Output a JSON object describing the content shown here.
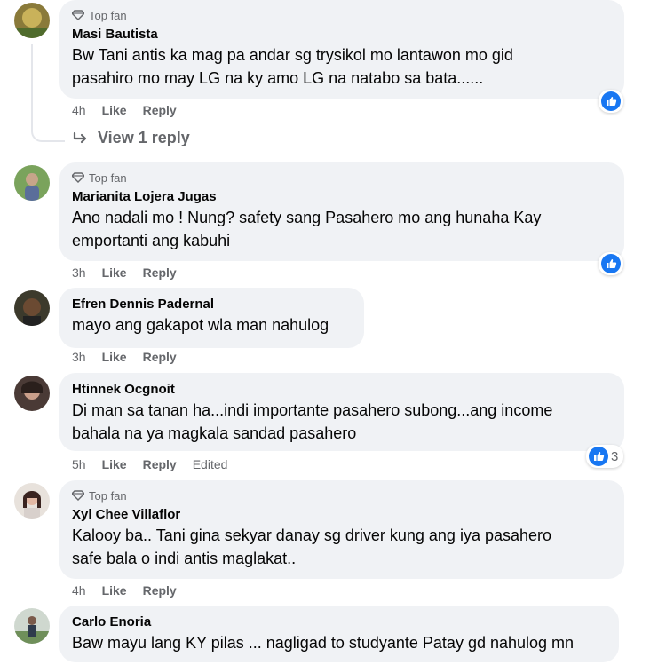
{
  "top_fan_label": "Top fan",
  "actions": {
    "like": "Like",
    "reply": "Reply",
    "edited": "Edited"
  },
  "view_reply": "View 1 reply",
  "comments": [
    {
      "name": "Masi Bautista",
      "top_fan": true,
      "lines": [
        "Bw Tani antis ka mag pa andar sg trysikol mo lantawon mo gid",
        "pasahiro mo may LG na ky amo LG na natabo sa bata......"
      ],
      "time": "4h",
      "reaction": "like",
      "reaction_count": ""
    },
    {
      "name": "Marianita Lojera Jugas",
      "top_fan": true,
      "lines": [
        "Ano nadali mo ! Nung? safety sang Pasahero mo ang hunaha Kay",
        "emportanti ang kabuhi"
      ],
      "time": "3h",
      "reaction": "like",
      "reaction_count": ""
    },
    {
      "name": "Efren Dennis Padernal",
      "top_fan": false,
      "lines": [
        "mayo ang gakapot wla man nahulog"
      ],
      "time": "3h"
    },
    {
      "name": "Htinnek Ocgnoit",
      "top_fan": false,
      "lines": [
        "Di man sa tanan ha...indi importante pasahero subong...ang income",
        "bahala na ya magkala sandad pasahero"
      ],
      "time": "5h",
      "edited": true,
      "reaction": "like",
      "reaction_count": "3"
    },
    {
      "name": "Xyl Chee Villaflor",
      "top_fan": true,
      "lines": [
        "Kalooy ba.. Tani gina sekyar danay sg driver kung ang iya pasahero",
        "safe bala o indi antis maglakat.."
      ],
      "time": "4h"
    },
    {
      "name": "Carlo Enoria",
      "top_fan": false,
      "lines": [
        "Baw mayu lang KY pilas ... nagligad to studyante Patay gd nahulog mn"
      ]
    }
  ],
  "colors": {
    "bubble": "#f0f2f5",
    "like_blue": "#1877f2",
    "muted": "#65676b"
  }
}
